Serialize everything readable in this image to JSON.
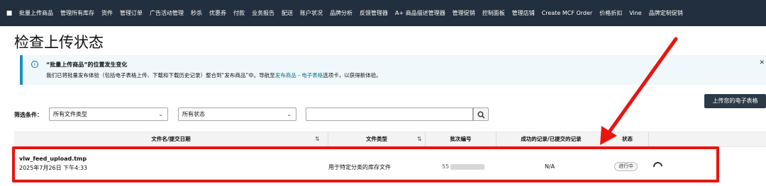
{
  "nav": {
    "menu_icon": "menu-icon",
    "items": [
      "批量上传商品",
      "管理所有库存",
      "货件",
      "管理订单",
      "广告活动管理",
      "秒杀",
      "优惠券",
      "付款",
      "业务报告",
      "配送",
      "账户状况",
      "品牌分析",
      "反馈管理器",
      "A+ 商品描述管理器",
      "管理促销",
      "控制面板",
      "管理店铺",
      "Create MCF Order",
      "价格折扣",
      "Vine",
      "品牌定制促销"
    ]
  },
  "page": {
    "title": "检查上传状态"
  },
  "banner": {
    "title": "“批量上传商品”的位置发生变化",
    "text_before": "我们已将批量发布体验（包括电子表格上传、下载和下载历史记录）整合到“发布商品”中。导航至",
    "link": "发布商品 - 电子表格",
    "text_after": "选项卡，以获得新体验。",
    "info_icon": "info-icon",
    "close_icon": "close-icon"
  },
  "upload_button": "上传您的电子表格",
  "filters": {
    "label": "筛选条件：",
    "file_type": "所有文件类型",
    "status": "所有状态",
    "search_placeholder": ""
  },
  "table": {
    "headers": {
      "file_name_date": "文件名/提交日期",
      "file_type": "文件类型",
      "batch_id": "批次编号",
      "records": "成功的记录/已提交的记录",
      "status": "状态"
    },
    "rows": [
      {
        "file_name": "vlw_feed_upload.tmp",
        "date": "2025年7月26日 下午4:33",
        "file_type": "用于特定分类的库存文件",
        "batch_prefix": "55",
        "records": "N/A",
        "status": "进行中"
      }
    ]
  },
  "colors": {
    "nav_bg": "#222f3e",
    "banner_accent": "#1b8fc2",
    "highlight": "#e8150f",
    "arrow": "#e8150f"
  }
}
